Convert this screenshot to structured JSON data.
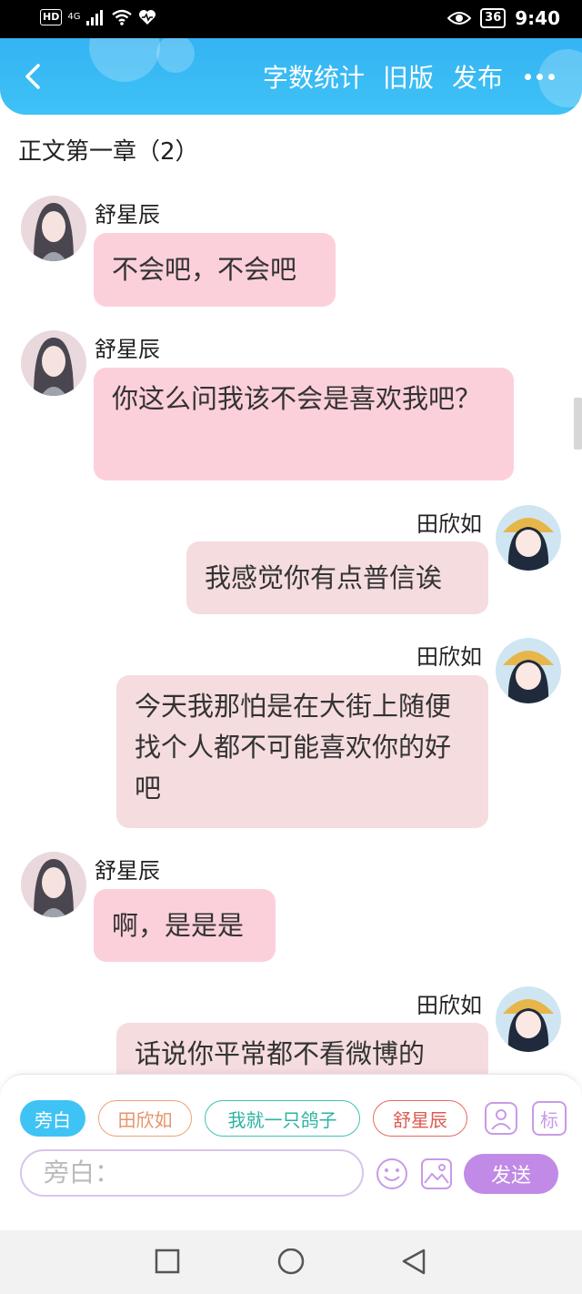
{
  "status_bar": {
    "hd": "HD",
    "network": "4G",
    "battery": "36",
    "time": "9:40"
  },
  "header": {
    "actions": [
      "字数统计",
      "旧版",
      "发布"
    ]
  },
  "chapter_title": "正文第一章（2）",
  "messages": [
    {
      "side": "left",
      "name": "舒星辰",
      "text": "不会吧，不会吧"
    },
    {
      "side": "left",
      "name": "舒星辰",
      "text": "你这么问我该不会是喜欢我吧？"
    },
    {
      "side": "right",
      "name": "田欣如",
      "text": "我感觉你有点普信诶"
    },
    {
      "side": "right",
      "name": "田欣如",
      "text": "今天我那怕是在大街上随便找个人都不可能喜欢你的好吧"
    },
    {
      "side": "left",
      "name": "舒星辰",
      "text": "啊，是是是"
    },
    {
      "side": "right",
      "name": "田欣如",
      "text": "话说你平常都不看微博的"
    }
  ],
  "composer": {
    "chips": [
      "旁白",
      "田欣如",
      "我就一只鸽子",
      "舒星辰"
    ],
    "mark_label": "标",
    "input_placeholder": "旁白：",
    "send_label": "发送"
  },
  "colors": {
    "header": "#3ec2f6",
    "left_bubble": "#fcd0da",
    "right_bubble": "#f5dcdf",
    "send": "#c08ae6"
  },
  "icons": [
    "back-arrow-icon",
    "more-dots-icon",
    "character-icon",
    "emoji-icon",
    "image-icon",
    "square-nav-icon",
    "circle-nav-icon",
    "triangle-nav-icon"
  ]
}
